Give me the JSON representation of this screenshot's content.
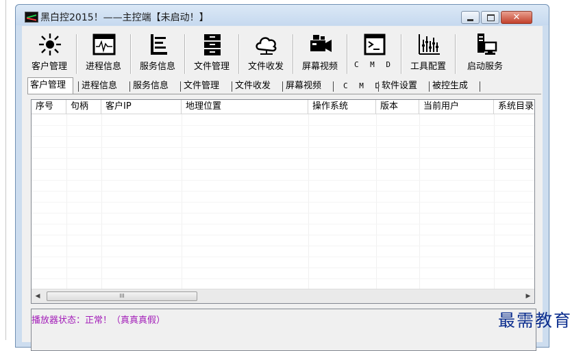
{
  "window": {
    "title": "黑白控2015！——主控端【未启动！】"
  },
  "toolbar": {
    "buttons": [
      {
        "label": "客户管理",
        "icon": "sun-icon"
      },
      {
        "label": "进程信息",
        "icon": "process-monitor-icon"
      },
      {
        "label": "服务信息",
        "icon": "service-list-icon"
      },
      {
        "label": "文件管理",
        "icon": "file-cabinet-icon"
      },
      {
        "label": "文件收发",
        "icon": "cloud-icon"
      },
      {
        "label": "屏幕视频",
        "icon": "video-camera-icon"
      },
      {
        "label": "C M D",
        "icon": "terminal-icon"
      },
      {
        "label": "工具配置",
        "icon": "equalizer-icon"
      },
      {
        "label": "启动服务",
        "icon": "server-computer-icon"
      }
    ]
  },
  "tabs": [
    {
      "label": "客户管理"
    },
    {
      "label": "进程信息"
    },
    {
      "label": "服务信息"
    },
    {
      "label": "文件管理"
    },
    {
      "label": "文件收发"
    },
    {
      "label": "屏幕视频"
    },
    {
      "label": "C M D"
    },
    {
      "label": "软件设置"
    },
    {
      "label": "被控生成"
    }
  ],
  "list": {
    "columns": [
      "序号",
      "句柄",
      "客户IP",
      "地理位置",
      "操作系统",
      "版本",
      "当前用户",
      "系统目录"
    ]
  },
  "scrollbar": {
    "left_arrow": "◀",
    "right_arrow": "▶",
    "thumb_grip": "III"
  },
  "status": {
    "text": "播放器状态：正常！（真真真假）"
  },
  "watermark": "最需教育",
  "colors": {
    "status_text": "#a21cb8",
    "watermark": "#0d2f8f",
    "close_button": "#c2402b"
  }
}
